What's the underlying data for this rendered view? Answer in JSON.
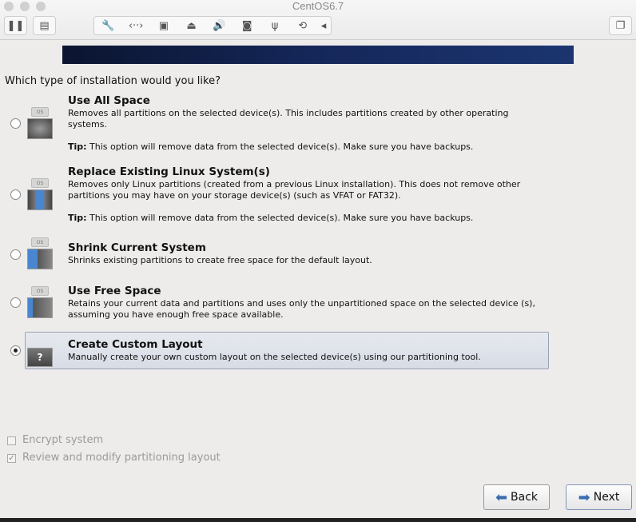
{
  "window": {
    "title": "CentOS6.7"
  },
  "toolbar": {
    "icons": [
      "pause-icon",
      "snapshot-icon",
      "wrench-icon",
      "network-icon",
      "disk-icon",
      "optical-drive-icon",
      "sound-icon",
      "camera-icon",
      "usb-icon",
      "sync-icon",
      "chevron-left-icon",
      "window-restore-icon"
    ]
  },
  "question": "Which type of installation would you like?",
  "options": [
    {
      "title": "Use All Space",
      "desc": "Removes all partitions on the selected device(s).  This includes partitions created by other operating systems.",
      "tip_label": "Tip:",
      "tip": " This option will remove data from the selected device(s).  Make sure you have backups.",
      "selected": false
    },
    {
      "title": "Replace Existing Linux System(s)",
      "desc": "Removes only Linux partitions (created from a previous Linux installation).  This does not remove other partitions you may have on your storage device(s) (such as VFAT or FAT32).",
      "tip_label": "Tip:",
      "tip": " This option will remove data from the selected device(s).  Make sure you have backups.",
      "selected": false
    },
    {
      "title": "Shrink Current System",
      "desc": "Shrinks existing partitions to create free space for the default layout.",
      "selected": false
    },
    {
      "title": "Use Free Space",
      "desc": "Retains your current data and partitions and uses only the unpartitioned space on the selected device (s), assuming you have enough free space available.",
      "selected": false
    },
    {
      "title": "Create Custom Layout",
      "desc": "Manually create your own custom layout on the selected device(s) using our partitioning tool.",
      "selected": true
    }
  ],
  "icon_os_label": "OS",
  "icon_custom_label": "?",
  "checkboxes": [
    {
      "label": "Encrypt system",
      "checked": false
    },
    {
      "label": "Review and modify partitioning layout",
      "checked": true
    }
  ],
  "buttons": {
    "back": "Back",
    "next": "Next"
  },
  "colors": {
    "accent": "#3a6db0",
    "selection": "#dfe3ea"
  }
}
